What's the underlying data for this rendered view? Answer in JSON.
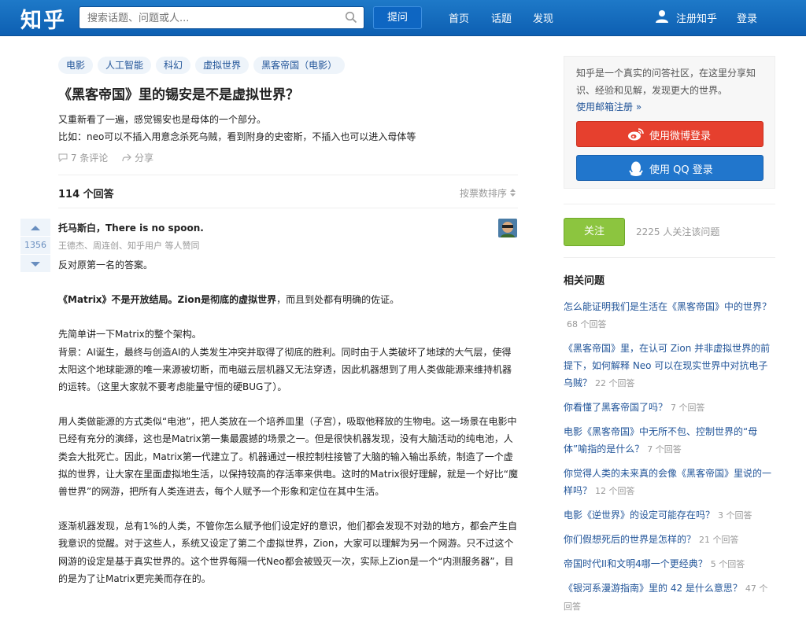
{
  "header": {
    "logo": "知乎",
    "search_placeholder": "搜索话题、问题或人...",
    "ask_label": "提问",
    "nav": [
      "首页",
      "话题",
      "发现"
    ],
    "register_label": "注册知乎",
    "login_label": "登录"
  },
  "question": {
    "tags": [
      "电影",
      "人工智能",
      "科幻",
      "虚拟世界",
      "黑客帝国（电影）"
    ],
    "title": "《黑客帝国》里的锡安是不是虚拟世界？",
    "desc_lines": [
      "又重新看了一遍，感觉锡安也是母体的一个部分。",
      "比如：neo可以不插入用意念杀死乌贼，看到附身的史密斯，不插入也可以进入母体等"
    ],
    "comments_label": "7 条评论",
    "share_label": "分享"
  },
  "answers": {
    "count_label": "114 个回答",
    "sort_label": "按票数排序"
  },
  "answer": {
    "votes": "1356",
    "author": "托马斯白，There is no spoon.",
    "voters": "王德杰、周连创、知乎用户 等人赞同",
    "p1": "反对原第一名的答案。",
    "p2_bold": "《Matrix》不是开放结局。Zion是彻底的虚拟世界",
    "p2_rest": "，而且到处都有明确的佐证。",
    "p3": "先简单讲一下Matrix的整个架构。",
    "p4": "背景：AI诞生，最终与创造AI的人类发生冲突并取得了彻底的胜利。同时由于人类破坏了地球的大气层，使得太阳这个地球能源的唯一来源被切断，而电磁云层机器又无法穿透，因此机器想到了用人类做能源来维持机器的运转。（这里大家就不要考虑能量守恒的硬BUG了）。",
    "p5": "用人类做能源的方式类似“电池”，把人类放在一个培养皿里（子宫），吸取他释放的生物电。这一场景在电影中已经有充分的演绎，这也是Matrix第一集最震撼的场景之一。但是很快机器发现，没有大脑活动的纯电池，人类会大批死亡。因此，Matrix第一代建立了。机器通过一根控制柱接管了大脑的输入输出系统，制造了一个虚拟的世界，让大家在里面虚拟地生活，以保持较高的存活率来供电。这时的Matrix很好理解，就是一个好比“魔兽世界”的网游，把所有人类连进去，每个人赋予一个形象和定位在其中生活。",
    "p6": "逐渐机器发现，总有1%的人类，不管你怎么赋予他们设定好的意识，他们都会发现不对劲的地方，都会产生自我意识的觉醒。对于这些人，系统又设定了第二个虚拟世界，Zion，大家可以理解为另一个网游。只不过这个网游的设定是基于真实世界的。这个世界每隔一代Neo都会被毁灭一次，实际上Zion是一个“内测服务器”，目的是为了让Matrix更完美而存在的。"
  },
  "sidebar": {
    "intro": "知乎是一个真实的问答社区，在这里分享知识、经验和见解，发现更大的世界。",
    "email_register": "使用邮箱注册 »",
    "weibo_login": "使用微博登录",
    "qq_login": "使用 QQ 登录",
    "follow_label": "关注",
    "followers_text": "2225 人关注该问题",
    "related_title": "相关问题",
    "related": [
      {
        "q": "怎么能证明我们是生活在《黑客帝国》中的世界？",
        "n": "68 个回答"
      },
      {
        "q": "《黑客帝国》里，在认可 Zion 并非虚拟世界的前提下，如何解释 Neo 可以在现实世界中对抗电子乌贼？",
        "n": "22 个回答"
      },
      {
        "q": "你看懂了黑客帝国了吗？",
        "n": "7 个回答"
      },
      {
        "q": "电影《黑客帝国》中无所不包、控制世界的“母体”喻指的是什么？",
        "n": "7 个回答"
      },
      {
        "q": "你觉得人类的未来真的会像《黑客帝国》里说的一样吗？",
        "n": "12 个回答"
      },
      {
        "q": "电影《逆世界》的设定可能存在吗？",
        "n": "3 个回答"
      },
      {
        "q": "你们假想死后的世界是怎样的？",
        "n": "21 个回答"
      },
      {
        "q": "帝国时代II和文明4哪一个更经典？",
        "n": "5 个回答"
      },
      {
        "q": "《银河系漫游指南》里的 42 是什么意思？",
        "n": "47 个回答"
      }
    ]
  },
  "colors": {
    "brand_blue": "#0e66c2",
    "link_blue": "#225599",
    "weibo_red": "#e6402e",
    "qq_blue": "#2176cc",
    "follow_green": "#8cc53f"
  }
}
